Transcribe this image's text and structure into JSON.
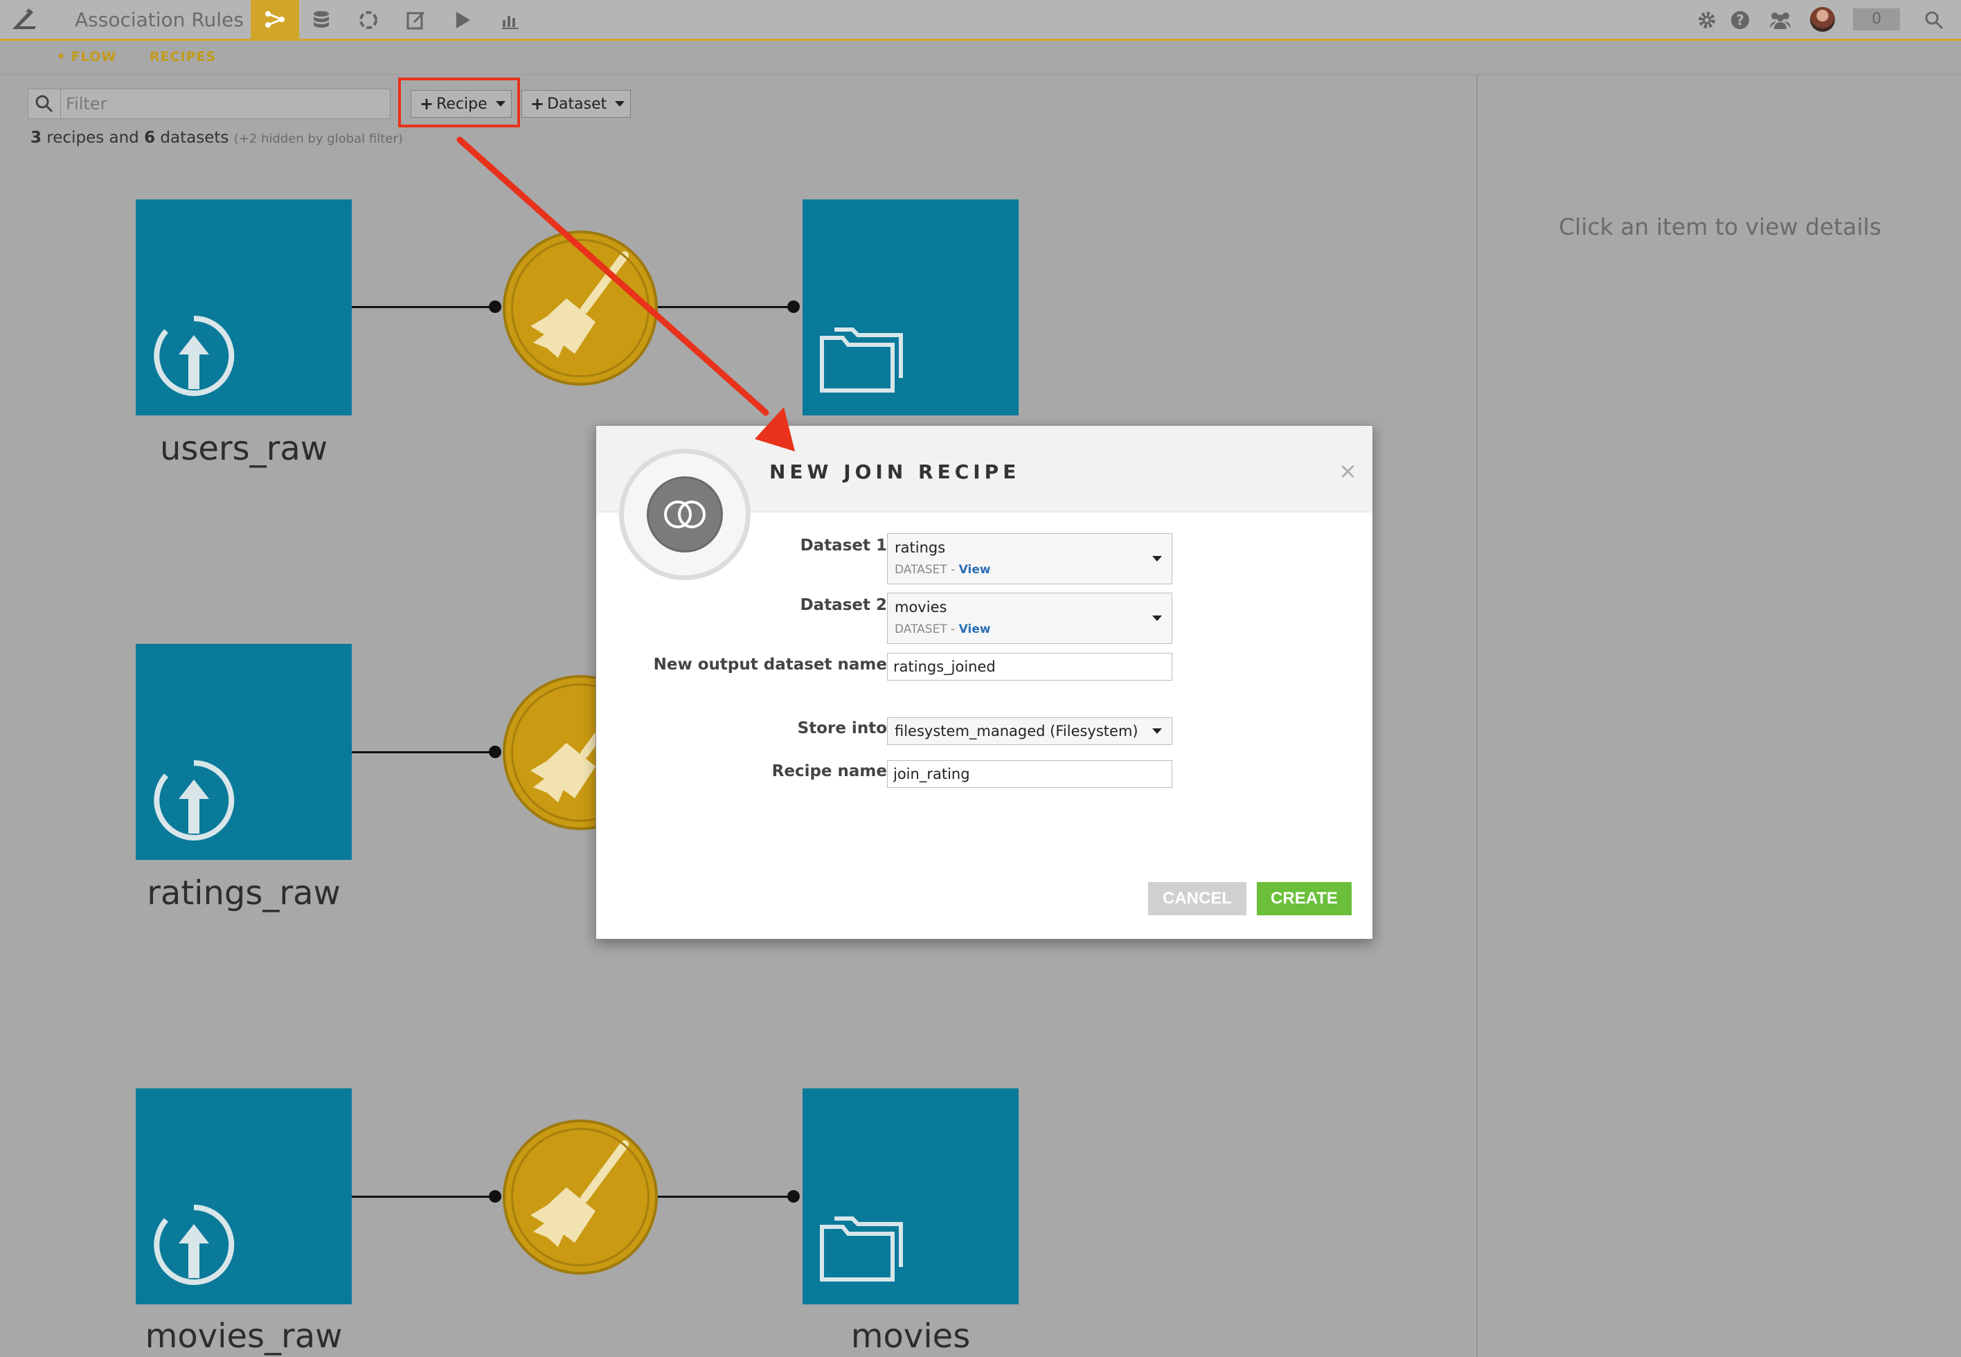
{
  "topbar": {
    "title": "Association Rules",
    "nav_icons": [
      "flow-icon",
      "datasets-icon",
      "recipes-icon",
      "notebook-icon",
      "run-icon",
      "dashboard-icon"
    ],
    "right_icons": [
      "gear-icon",
      "help-icon",
      "users-icon"
    ],
    "notification_count": "0",
    "accent_color": "#d1a52a"
  },
  "subnav": {
    "flow_label": "• FLOW",
    "recipes_label": "RECIPES"
  },
  "toolbar": {
    "filter_placeholder": "Filter",
    "recipe_button": "Recipe",
    "dataset_button": "Dataset"
  },
  "summary": {
    "recipes_count": "3",
    "recipes_text": "recipes and",
    "datasets_count": "6",
    "datasets_text": "datasets",
    "hidden_note": "(+2 hidden by global filter)"
  },
  "flow": {
    "datasets": [
      {
        "name": "users_raw",
        "type": "upload"
      },
      {
        "name": "ratings_raw",
        "type": "upload"
      },
      {
        "name": "movies_raw",
        "type": "upload"
      },
      {
        "name": "",
        "type": "folder"
      },
      {
        "name": "movies",
        "type": "folder"
      }
    ],
    "recipe_type": "prepare"
  },
  "right_panel": {
    "message": "Click an item to view details"
  },
  "modal": {
    "title": "NEW JOIN RECIPE",
    "close": "×",
    "dataset1_label": "Dataset 1",
    "dataset1_value": "ratings",
    "dataset1_sub": "DATASET -",
    "dataset1_link": "View",
    "dataset2_label": "Dataset 2",
    "dataset2_value": "movies",
    "dataset2_sub": "DATASET -",
    "dataset2_link": "View",
    "output_label": "New output dataset name",
    "output_value": "ratings_joined",
    "store_label": "Store into",
    "store_value": "filesystem_managed (Filesystem)",
    "recipe_name_label": "Recipe name",
    "recipe_name_value": "join_rating",
    "cancel_label": "CANCEL",
    "create_label": "CREATE",
    "create_color": "#6bbf3a"
  }
}
